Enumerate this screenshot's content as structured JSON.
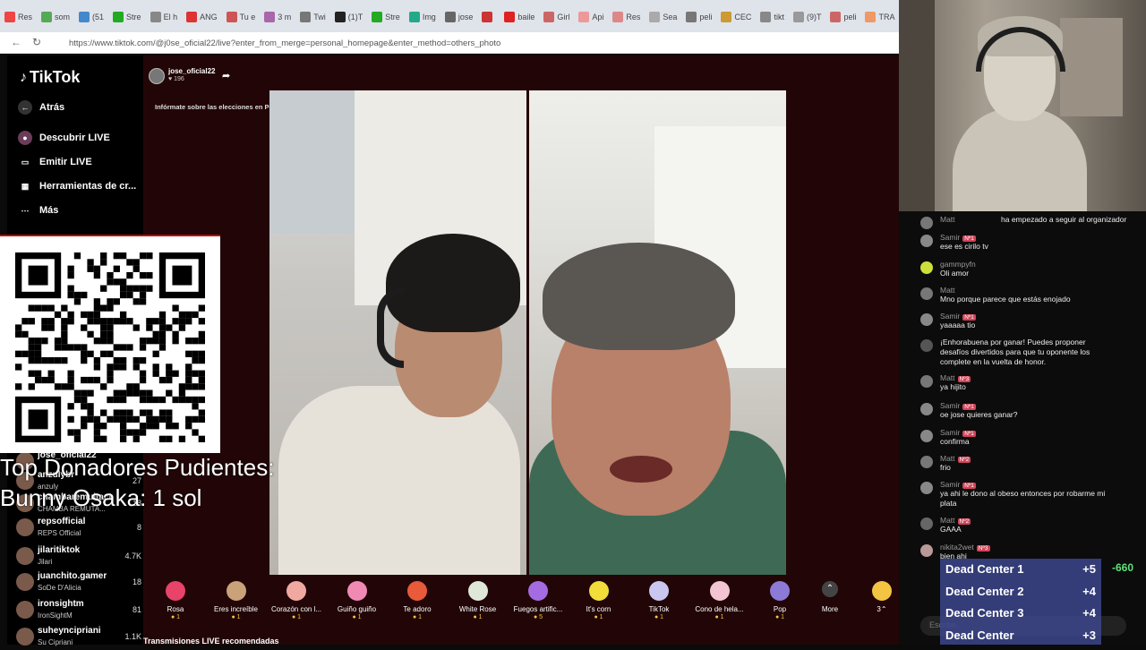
{
  "browser": {
    "tabs": [
      "Res",
      "som",
      "(51",
      "Stre",
      "El h",
      "ANG",
      "Tu e",
      "3 m",
      "Twi",
      "(1)T",
      "Stre",
      "Img",
      "jose",
      "",
      "baile",
      "Girl",
      "Api",
      "Res",
      "Sea",
      "peli",
      "CEC",
      "tikt",
      "(9)T",
      "peli",
      "TRA",
      "Tes"
    ],
    "url": "https://www.tiktok.com/@j0se_oficial22/live?enter_from_merge=personal_homepage&enter_method=others_photo"
  },
  "sidebar": {
    "logo": "TikTok",
    "nav": [
      {
        "label": "Atrás",
        "icon": "back-arrow-icon"
      },
      {
        "label": "Descubrir LIVE",
        "icon": "live-discover-icon"
      },
      {
        "label": "Emitir LIVE",
        "icon": "camera-icon"
      },
      {
        "label": "Herramientas de cr...",
        "icon": "tools-icon"
      },
      {
        "label": "Más",
        "icon": "more-dots-icon"
      }
    ],
    "streamers": [
      {
        "name": "jose_oficial22",
        "sub": "",
        "count": ""
      },
      {
        "name": "anzulybr",
        "sub": "anzuly",
        "count": "27"
      },
      {
        "name": "chambaremuitact",
        "sub": "CHAMBA REMUTA...",
        "count": "18"
      },
      {
        "name": "repsofficial",
        "sub": "REPS Official",
        "count": "8"
      },
      {
        "name": "jilaritiktok",
        "sub": "Jilari",
        "count": "4.7K"
      },
      {
        "name": "juanchito.gamer",
        "sub": "SoDe D'Alicia",
        "count": "18"
      },
      {
        "name": "ironsightm",
        "sub": "IronSightM",
        "count": "81"
      },
      {
        "name": "suheyncipriani",
        "sub": "Su Cipriani",
        "count": "1.1K"
      }
    ]
  },
  "stream": {
    "host_name": "jose_oficial22",
    "host_likes": "196",
    "info_banner": "Infórmate sobre las elecciones en Perú"
  },
  "gifts": [
    {
      "label": "Rosa",
      "price": "1",
      "color": "#e8436a"
    },
    {
      "label": "Eres increíble",
      "price": "1",
      "color": "#c9a27a"
    },
    {
      "label": "Corazón con l...",
      "price": "1",
      "color": "#f0a9a0"
    },
    {
      "label": "Guiño guiño",
      "price": "1",
      "color": "#f08ab4"
    },
    {
      "label": "Te adoro",
      "price": "1",
      "color": "#e85a3a"
    },
    {
      "label": "White Rose",
      "price": "1",
      "color": "#dfe8d8"
    },
    {
      "label": "Fuegos artific...",
      "price": "5",
      "color": "#a56be0"
    },
    {
      "label": "It's corn",
      "price": "1",
      "color": "#f2dd3a"
    },
    {
      "label": "TikTok",
      "price": "1",
      "color": "#c9c6f0"
    },
    {
      "label": "Cono de hela...",
      "price": "1",
      "color": "#f3c5d2"
    },
    {
      "label": "Pop",
      "price": "1",
      "color": "#8c7bd6"
    }
  ],
  "gift_more": "More",
  "coins": "3",
  "recommended_title": "Transmisiones LIVE recomendadas",
  "overlay": {
    "donors_title": "Top Donadores Pudientes:",
    "donor_line": "Bunny Osaka: 1 sol"
  },
  "chat": [
    {
      "user": "Matt",
      "badge": "",
      "level": "",
      "text": "ha empezado a seguir al organizador",
      "inline": true
    },
    {
      "user": "Samir",
      "badge": "",
      "level": "Nº1",
      "text": "ese es cirilo tv"
    },
    {
      "user": "gammpyfn",
      "badge": "",
      "level": "",
      "text": "Oli amor"
    },
    {
      "user": "Matt",
      "badge": "",
      "level": "",
      "text": "Mno porque parece que estás enojado"
    },
    {
      "user": "Samir",
      "badge": "",
      "level": "Nº1",
      "text": "yaaaaa tio"
    },
    {
      "user": "",
      "badge": "",
      "level": "",
      "text": "¡Enhorabuena por ganar! Puedes proponer desafíos divertidos para que tu oponente los complete en la vuelta de honor."
    },
    {
      "user": "Matt",
      "badge": "",
      "level": "Nº3",
      "text": "ya hijito"
    },
    {
      "user": "Samir",
      "badge": "",
      "level": "Nº1",
      "text": "oe jose quieres ganar?"
    },
    {
      "user": "Samir",
      "badge": "",
      "level": "Nº1",
      "text": "confirma"
    },
    {
      "user": "Matt",
      "badge": "",
      "level": "Nº2",
      "text": "frio"
    },
    {
      "user": "Samir",
      "badge": "",
      "level": "Nº1",
      "text": "ya ahi le dono al obeso entonces por robarme mi plata"
    },
    {
      "user": "Matt",
      "badge": "",
      "level": "Nº2",
      "text": "GAAA"
    },
    {
      "user": "nikita2wet",
      "badge": "",
      "level": "Nº3",
      "text": "bien ahi"
    }
  ],
  "chat_input_placeholder": "Escribe...",
  "dead_center": {
    "rows": [
      {
        "name": "Dead Center 1",
        "pts": "+5"
      },
      {
        "name": "Dead Center 2",
        "pts": "+4"
      },
      {
        "name": "Dead Center 3",
        "pts": "+4"
      },
      {
        "name": "Dead Center",
        "pts": "+3"
      }
    ],
    "score": "-660"
  }
}
